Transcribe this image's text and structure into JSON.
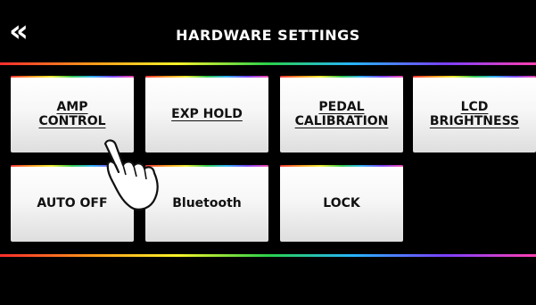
{
  "header": {
    "back_icon": "double-chevron-left-icon",
    "back_label": "«",
    "title": "HARDWARE SETTINGS"
  },
  "buttons": [
    {
      "label": "AMP\nCONTROL"
    },
    {
      "label": "EXP HOLD"
    },
    {
      "label": "PEDAL\nCALIBRATION"
    },
    {
      "label": "LCD\nBRIGHTNESS"
    },
    {
      "label": "AUTO OFF"
    },
    {
      "label": "Bluetooth"
    },
    {
      "label": "LOCK"
    }
  ],
  "overlay": {
    "hand_icon": "pointing-hand-icon"
  },
  "colors": {
    "background": "#000000",
    "button_face": "#f7f7f7",
    "accent_gradient": [
      "#ff2d2d",
      "#ff9f1a",
      "#f8f22a",
      "#2ad14a",
      "#27b4ff",
      "#7a40ff",
      "#ff3fb0"
    ]
  }
}
